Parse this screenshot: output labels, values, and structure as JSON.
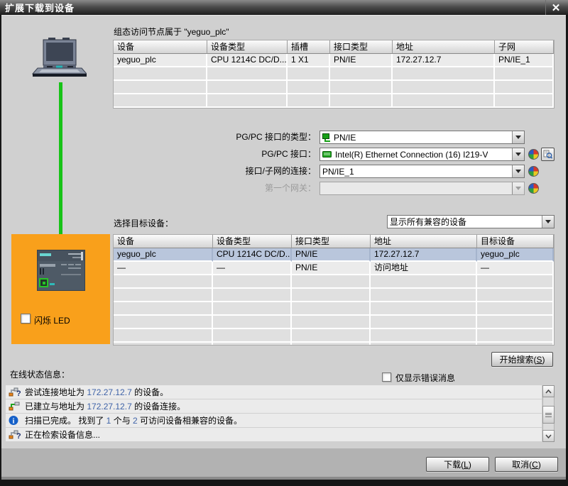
{
  "window": {
    "title": "扩展下载到设备",
    "close_glyph": "✕"
  },
  "config_section": {
    "caption": "组态访问节点属于 \"yeguo_plc\"",
    "table": {
      "headers": [
        "设备",
        "设备类型",
        "插槽",
        "接口类型",
        "地址",
        "子网"
      ],
      "rows": [
        [
          "yeguo_plc",
          "CPU 1214C DC/D...",
          "1 X1",
          "PN/IE",
          "172.27.12.7",
          "PN/IE_1"
        ]
      ]
    }
  },
  "pgpc": {
    "type_label": "PG/PC 接口的类型：",
    "type_value": "PN/IE",
    "type_icon": "pnie-plug-icon",
    "iface_label": "PG/PC 接口：",
    "iface_value": "Intel(R) Ethernet Connection (16) I219-V",
    "iface_icon": "network-card-icon",
    "subnet_label": "接口/子网的连接：",
    "subnet_value": "PN/IE_1",
    "gateway_label": "第一个网关：",
    "gateway_value": ""
  },
  "target_section": {
    "select_label": "选择目标设备：",
    "filter_value": "显示所有兼容的设备",
    "table": {
      "headers": [
        "设备",
        "设备类型",
        "接口类型",
        "地址",
        "目标设备"
      ],
      "rows": [
        [
          "yeguo_plc",
          "CPU 1214C DC/D...",
          "PN/IE",
          "172.27.12.7",
          "yeguo_plc"
        ],
        [
          "—",
          "—",
          "PN/IE",
          "访问地址",
          "—"
        ]
      ],
      "selected_row": 0
    },
    "flash_led_label": "闪烁 LED",
    "start_search_button": {
      "pre": "开始搜索(",
      "key": "S",
      "post": ")"
    }
  },
  "status_section": {
    "label": "在线状态信息：",
    "only_errors_label": "仅显示错误消息",
    "messages": [
      {
        "icon": "connect-attempt-icon",
        "segments": [
          {
            "t": "尝试连接地址为 "
          },
          {
            "t": "172.27.12.7",
            "blue": true
          },
          {
            "t": " 的设备。"
          }
        ]
      },
      {
        "icon": "connect-established-icon",
        "segments": [
          {
            "t": "已建立与地址为 "
          },
          {
            "t": "172.27.12.7",
            "blue": true
          },
          {
            "t": " 的设备连接。"
          }
        ]
      },
      {
        "icon": "info-icon",
        "segments": [
          {
            "t": "扫描已完成。 找到了 "
          },
          {
            "t": "1",
            "blue": true
          },
          {
            "t": " 个与 "
          },
          {
            "t": "2",
            "blue": true
          },
          {
            "t": " 可访问设备相兼容的设备。"
          }
        ]
      },
      {
        "icon": "connect-attempt-icon",
        "segments": [
          {
            "t": "正在检索设备信息..."
          }
        ]
      }
    ]
  },
  "footer": {
    "download_button": {
      "pre": "下载(",
      "key": "L",
      "post": ")"
    },
    "cancel_button": {
      "pre": "取消(",
      "key": "C",
      "post": ")"
    }
  },
  "colors": {
    "siemens_orange": "#f9a01b",
    "cable_green": "#17c317",
    "selection_blue": "#b9c6dc",
    "value_blue": "#3f63a8",
    "info_blue": "#1560c8"
  }
}
